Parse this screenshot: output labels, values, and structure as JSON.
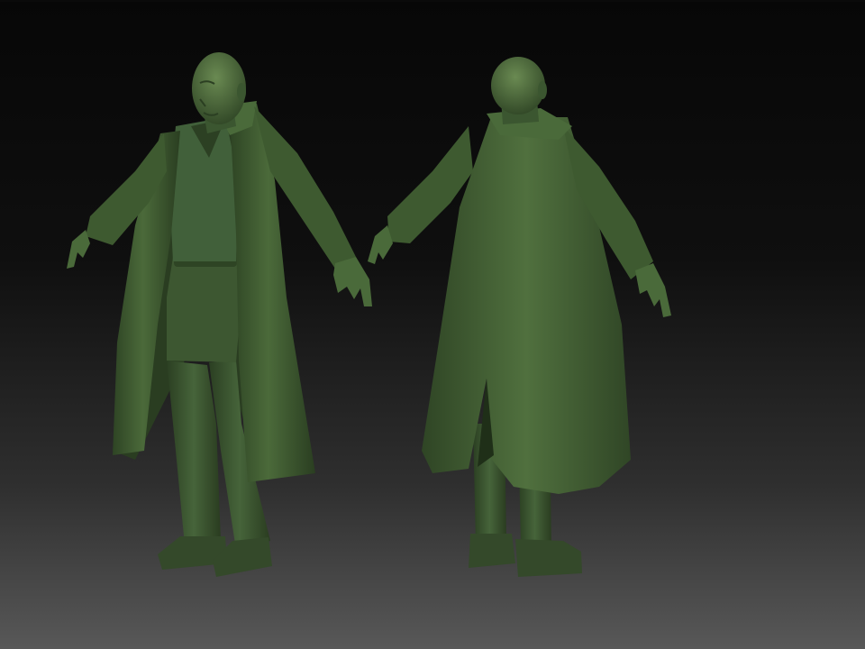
{
  "scene": {
    "description_visible_text": "",
    "material_color": "#3f5a32",
    "material_shadow": "#1e2d18",
    "material_highlight": "#6c8a55",
    "background_top": "#070707",
    "background_bottom": "#585858",
    "models": [
      {
        "name": "character-front-three-quarter-view"
      },
      {
        "name": "character-back-view"
      }
    ]
  }
}
